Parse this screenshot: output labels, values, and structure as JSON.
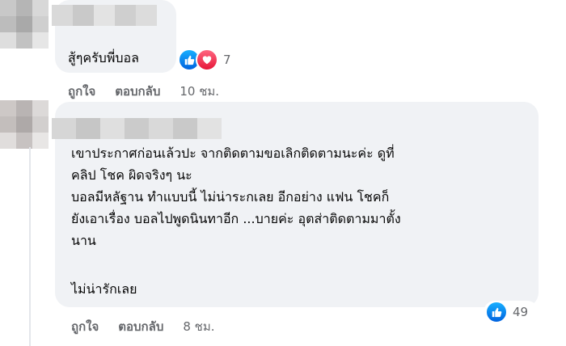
{
  "comments": [
    {
      "text": "สู้ๆครับพี่บอล",
      "reaction_count": "7",
      "like_label": "ถูกใจ",
      "reply_label": "ตอบกลับ",
      "time": "10 ชม."
    },
    {
      "text": "เขาประกาศก่อนเล้วปะ จากติดตามขอเลิกติดตามนะค่ะ ดูที่\nคลิป โชค ผิดจริงๆ นะ\nบอลมีหลัฐาน ทำแบบนี้ ไม่น่าระกเลย อีกอย่าง แฟน โชคก็\nยังเอาเรื่อง บอลไปพูดนินทาอีก ...บายค่ะ อุตส่าติดตามมาตั้ง\nนาน",
      "text_extra": "ไม่น่ารักเลย",
      "reaction_count": "49",
      "like_label": "ถูกใจ",
      "reply_label": "ตอบกลับ",
      "time": "8 ชม."
    }
  ],
  "colors": {
    "bubble": "#f0f2f5",
    "meta_text": "#65676b",
    "like_blue": "#0866ff",
    "love_red": "#f33e58"
  },
  "icons": [
    "like-icon",
    "love-icon",
    "avatar-blurred",
    "name-blurred"
  ]
}
